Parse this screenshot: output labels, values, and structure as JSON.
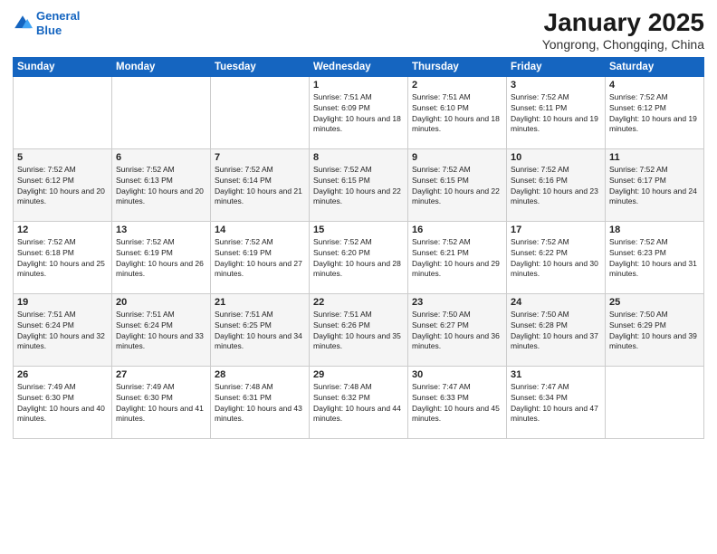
{
  "logo": {
    "line1": "General",
    "line2": "Blue"
  },
  "title": "January 2025",
  "location": "Yongrong, Chongqing, China",
  "weekdays": [
    "Sunday",
    "Monday",
    "Tuesday",
    "Wednesday",
    "Thursday",
    "Friday",
    "Saturday"
  ],
  "weeks": [
    [
      {
        "day": "",
        "sunrise": "",
        "sunset": "",
        "daylight": ""
      },
      {
        "day": "",
        "sunrise": "",
        "sunset": "",
        "daylight": ""
      },
      {
        "day": "",
        "sunrise": "",
        "sunset": "",
        "daylight": ""
      },
      {
        "day": "1",
        "sunrise": "Sunrise: 7:51 AM",
        "sunset": "Sunset: 6:09 PM",
        "daylight": "Daylight: 10 hours and 18 minutes."
      },
      {
        "day": "2",
        "sunrise": "Sunrise: 7:51 AM",
        "sunset": "Sunset: 6:10 PM",
        "daylight": "Daylight: 10 hours and 18 minutes."
      },
      {
        "day": "3",
        "sunrise": "Sunrise: 7:52 AM",
        "sunset": "Sunset: 6:11 PM",
        "daylight": "Daylight: 10 hours and 19 minutes."
      },
      {
        "day": "4",
        "sunrise": "Sunrise: 7:52 AM",
        "sunset": "Sunset: 6:12 PM",
        "daylight": "Daylight: 10 hours and 19 minutes."
      }
    ],
    [
      {
        "day": "5",
        "sunrise": "Sunrise: 7:52 AM",
        "sunset": "Sunset: 6:12 PM",
        "daylight": "Daylight: 10 hours and 20 minutes."
      },
      {
        "day": "6",
        "sunrise": "Sunrise: 7:52 AM",
        "sunset": "Sunset: 6:13 PM",
        "daylight": "Daylight: 10 hours and 20 minutes."
      },
      {
        "day": "7",
        "sunrise": "Sunrise: 7:52 AM",
        "sunset": "Sunset: 6:14 PM",
        "daylight": "Daylight: 10 hours and 21 minutes."
      },
      {
        "day": "8",
        "sunrise": "Sunrise: 7:52 AM",
        "sunset": "Sunset: 6:15 PM",
        "daylight": "Daylight: 10 hours and 22 minutes."
      },
      {
        "day": "9",
        "sunrise": "Sunrise: 7:52 AM",
        "sunset": "Sunset: 6:15 PM",
        "daylight": "Daylight: 10 hours and 22 minutes."
      },
      {
        "day": "10",
        "sunrise": "Sunrise: 7:52 AM",
        "sunset": "Sunset: 6:16 PM",
        "daylight": "Daylight: 10 hours and 23 minutes."
      },
      {
        "day": "11",
        "sunrise": "Sunrise: 7:52 AM",
        "sunset": "Sunset: 6:17 PM",
        "daylight": "Daylight: 10 hours and 24 minutes."
      }
    ],
    [
      {
        "day": "12",
        "sunrise": "Sunrise: 7:52 AM",
        "sunset": "Sunset: 6:18 PM",
        "daylight": "Daylight: 10 hours and 25 minutes."
      },
      {
        "day": "13",
        "sunrise": "Sunrise: 7:52 AM",
        "sunset": "Sunset: 6:19 PM",
        "daylight": "Daylight: 10 hours and 26 minutes."
      },
      {
        "day": "14",
        "sunrise": "Sunrise: 7:52 AM",
        "sunset": "Sunset: 6:19 PM",
        "daylight": "Daylight: 10 hours and 27 minutes."
      },
      {
        "day": "15",
        "sunrise": "Sunrise: 7:52 AM",
        "sunset": "Sunset: 6:20 PM",
        "daylight": "Daylight: 10 hours and 28 minutes."
      },
      {
        "day": "16",
        "sunrise": "Sunrise: 7:52 AM",
        "sunset": "Sunset: 6:21 PM",
        "daylight": "Daylight: 10 hours and 29 minutes."
      },
      {
        "day": "17",
        "sunrise": "Sunrise: 7:52 AM",
        "sunset": "Sunset: 6:22 PM",
        "daylight": "Daylight: 10 hours and 30 minutes."
      },
      {
        "day": "18",
        "sunrise": "Sunrise: 7:52 AM",
        "sunset": "Sunset: 6:23 PM",
        "daylight": "Daylight: 10 hours and 31 minutes."
      }
    ],
    [
      {
        "day": "19",
        "sunrise": "Sunrise: 7:51 AM",
        "sunset": "Sunset: 6:24 PM",
        "daylight": "Daylight: 10 hours and 32 minutes."
      },
      {
        "day": "20",
        "sunrise": "Sunrise: 7:51 AM",
        "sunset": "Sunset: 6:24 PM",
        "daylight": "Daylight: 10 hours and 33 minutes."
      },
      {
        "day": "21",
        "sunrise": "Sunrise: 7:51 AM",
        "sunset": "Sunset: 6:25 PM",
        "daylight": "Daylight: 10 hours and 34 minutes."
      },
      {
        "day": "22",
        "sunrise": "Sunrise: 7:51 AM",
        "sunset": "Sunset: 6:26 PM",
        "daylight": "Daylight: 10 hours and 35 minutes."
      },
      {
        "day": "23",
        "sunrise": "Sunrise: 7:50 AM",
        "sunset": "Sunset: 6:27 PM",
        "daylight": "Daylight: 10 hours and 36 minutes."
      },
      {
        "day": "24",
        "sunrise": "Sunrise: 7:50 AM",
        "sunset": "Sunset: 6:28 PM",
        "daylight": "Daylight: 10 hours and 37 minutes."
      },
      {
        "day": "25",
        "sunrise": "Sunrise: 7:50 AM",
        "sunset": "Sunset: 6:29 PM",
        "daylight": "Daylight: 10 hours and 39 minutes."
      }
    ],
    [
      {
        "day": "26",
        "sunrise": "Sunrise: 7:49 AM",
        "sunset": "Sunset: 6:30 PM",
        "daylight": "Daylight: 10 hours and 40 minutes."
      },
      {
        "day": "27",
        "sunrise": "Sunrise: 7:49 AM",
        "sunset": "Sunset: 6:30 PM",
        "daylight": "Daylight: 10 hours and 41 minutes."
      },
      {
        "day": "28",
        "sunrise": "Sunrise: 7:48 AM",
        "sunset": "Sunset: 6:31 PM",
        "daylight": "Daylight: 10 hours and 43 minutes."
      },
      {
        "day": "29",
        "sunrise": "Sunrise: 7:48 AM",
        "sunset": "Sunset: 6:32 PM",
        "daylight": "Daylight: 10 hours and 44 minutes."
      },
      {
        "day": "30",
        "sunrise": "Sunrise: 7:47 AM",
        "sunset": "Sunset: 6:33 PM",
        "daylight": "Daylight: 10 hours and 45 minutes."
      },
      {
        "day": "31",
        "sunrise": "Sunrise: 7:47 AM",
        "sunset": "Sunset: 6:34 PM",
        "daylight": "Daylight: 10 hours and 47 minutes."
      },
      {
        "day": "",
        "sunrise": "",
        "sunset": "",
        "daylight": ""
      }
    ]
  ]
}
